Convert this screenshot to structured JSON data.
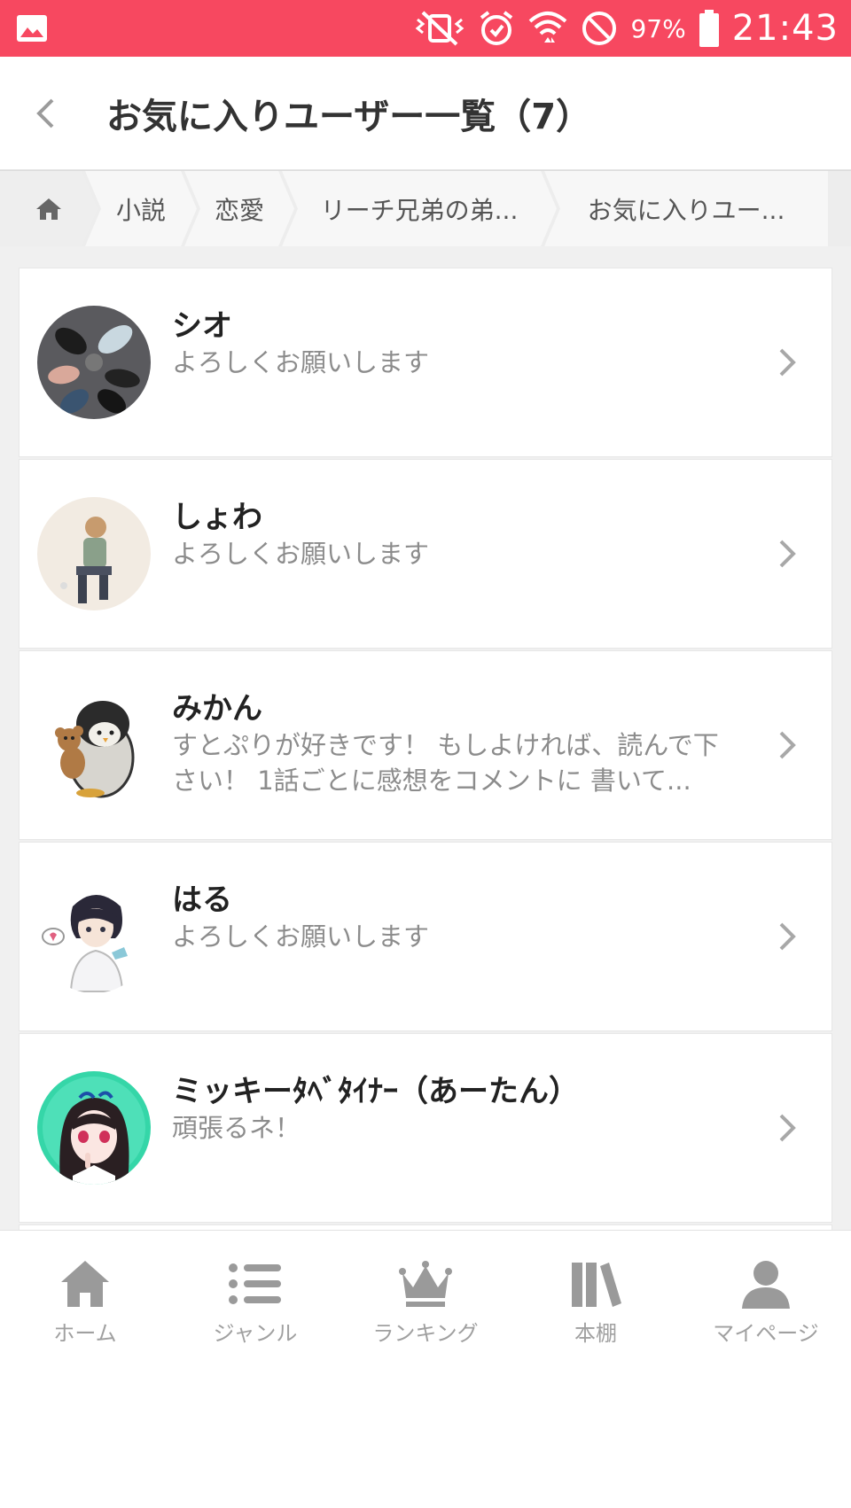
{
  "status_bar": {
    "battery_percent": "97%",
    "time": "21:43",
    "icons": [
      "image-icon",
      "vibrate-off-icon",
      "alarm-icon",
      "wifi-icon",
      "do-not-disturb-icon",
      "battery-icon"
    ],
    "background_color": "#f74860"
  },
  "app_bar": {
    "title": "お気に入りユーザー一覧（7）"
  },
  "breadcrumb": {
    "items": [
      {
        "label": ""
      },
      {
        "label": "小説"
      },
      {
        "label": "恋愛"
      },
      {
        "label": "リーチ兄弟の弟..."
      },
      {
        "label": "お気に入りユー..."
      }
    ]
  },
  "users": [
    {
      "name": "シオ",
      "description": "よろしくお願いします",
      "avatar": "shoes-photo"
    },
    {
      "name": "しょわ",
      "description": "よろしくお願いします",
      "avatar": "anime-boy-sketch"
    },
    {
      "name": "みかん",
      "description": "すとぷりが好きです！ もしよければ、読んで下さい！ 1話ごとに感想をコメントに 書いて...",
      "avatar": "penguin-with-bear"
    },
    {
      "name": "はる",
      "description": "よろしくお願いします",
      "avatar": "anime-boy-hoodie"
    },
    {
      "name": "ミッキーﾀﾍﾞﾀｲﾅｰ（あーたん）",
      "description": "頑張るネ！",
      "avatar": "anime-girl-green"
    }
  ],
  "bottom_nav": {
    "items": [
      {
        "label": "ホーム",
        "icon": "home-icon"
      },
      {
        "label": "ジャンル",
        "icon": "list-icon"
      },
      {
        "label": "ランキング",
        "icon": "crown-icon"
      },
      {
        "label": "本棚",
        "icon": "bookshelf-icon"
      },
      {
        "label": "マイページ",
        "icon": "person-icon"
      }
    ]
  }
}
